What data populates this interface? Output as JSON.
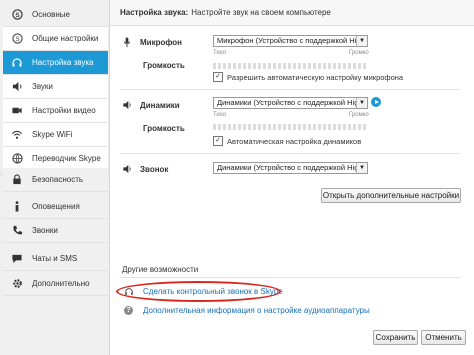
{
  "sidebar": {
    "items": [
      {
        "label": "Основные"
      },
      {
        "label": "Общие настройки"
      },
      {
        "label": "Настройка звука"
      },
      {
        "label": "Звуки"
      },
      {
        "label": "Настройки видео"
      },
      {
        "label": "Skype WiFi"
      },
      {
        "label": "Переводчик Skype"
      },
      {
        "label": "Безопасность"
      },
      {
        "label": "Оповещения"
      },
      {
        "label": "Звонки"
      },
      {
        "label": "Чаты и SMS"
      },
      {
        "label": "Дополнительно"
      }
    ]
  },
  "header": {
    "title": "Настройка звука:",
    "subtitle": "Настройте звук на своем компьютере"
  },
  "microphone": {
    "label": "Микрофон",
    "device": "Микрофон (Устройство с поддержкой Hig",
    "volume_label": "Громкость",
    "quiet": "Тихо",
    "loud": "Громко",
    "auto_label": "Разрешить автоматическую настройку микрофона"
  },
  "speakers": {
    "label": "Динамики",
    "device": "Динамики (Устройство с поддержкой High",
    "volume_label": "Громкость",
    "quiet": "Тихо",
    "loud": "Громко",
    "auto_label": "Автоматическая настройка динамиков"
  },
  "ringer": {
    "label": "Звонок",
    "device": "Динамики (Устройство с поддержкой High"
  },
  "open_advanced": "Открыть дополнительные настройки",
  "other": {
    "title": "Другие возможности",
    "test_call": "Сделать контрольный звонок в Skype",
    "audio_info": "Дополнительная информация о настройке аудиоаппаратуры"
  },
  "buttons": {
    "save": "Сохранить",
    "cancel": "Отменить"
  },
  "colors": {
    "accent": "#1d9ad6",
    "highlight": "#d9261c",
    "link": "#1a6fb8"
  }
}
